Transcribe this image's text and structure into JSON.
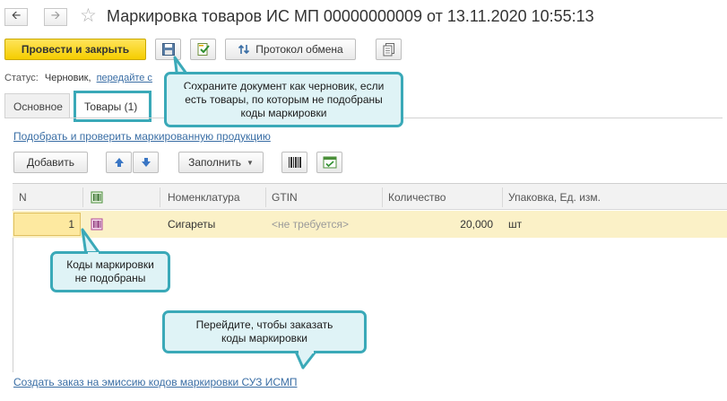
{
  "window": {
    "title": "Маркировка товаров ИС МП 00000000009 от 13.11.2020 10:55:13"
  },
  "toolbar": {
    "post_and_close_label": "Провести и закрыть",
    "exchange_log_label": "Протокол обмена"
  },
  "status": {
    "label": "Статус:",
    "value": "Черновик,",
    "link": "передайте с"
  },
  "tabs": [
    {
      "label": "Основное"
    },
    {
      "label": "Товары (1)"
    }
  ],
  "links": {
    "select_and_check": "Подобрать и проверить маркированную продукцию",
    "create_order": "Создать заказ на эмиссию кодов маркировки СУЗ ИСМП"
  },
  "table_toolbar": {
    "add_label": "Добавить",
    "fill_label": "Заполнить"
  },
  "table": {
    "columns": [
      "N",
      "Номенклатура",
      "GTIN",
      "Количество",
      "Упаковка, Ед. изм."
    ],
    "rows": [
      {
        "n": "1",
        "nomenclature": "Сигареты",
        "gtin": "<не требуется>",
        "quantity": "20,000",
        "unit": "шт"
      }
    ]
  },
  "callouts": {
    "save_draft": "Сохраните документ как черновик, если есть товары, по которым не подобраны коды маркировки",
    "codes_not_selected": "Коды маркировки не подобраны",
    "go_order": "Перейдите, чтобы заказать коды маркировки"
  },
  "colors": {
    "accent": "#3aa9b8",
    "callout_fill": "#dff3f6",
    "primary_button": "#f5cd00",
    "selected_row": "#fbf1c7",
    "link": "#3a6ea5"
  }
}
